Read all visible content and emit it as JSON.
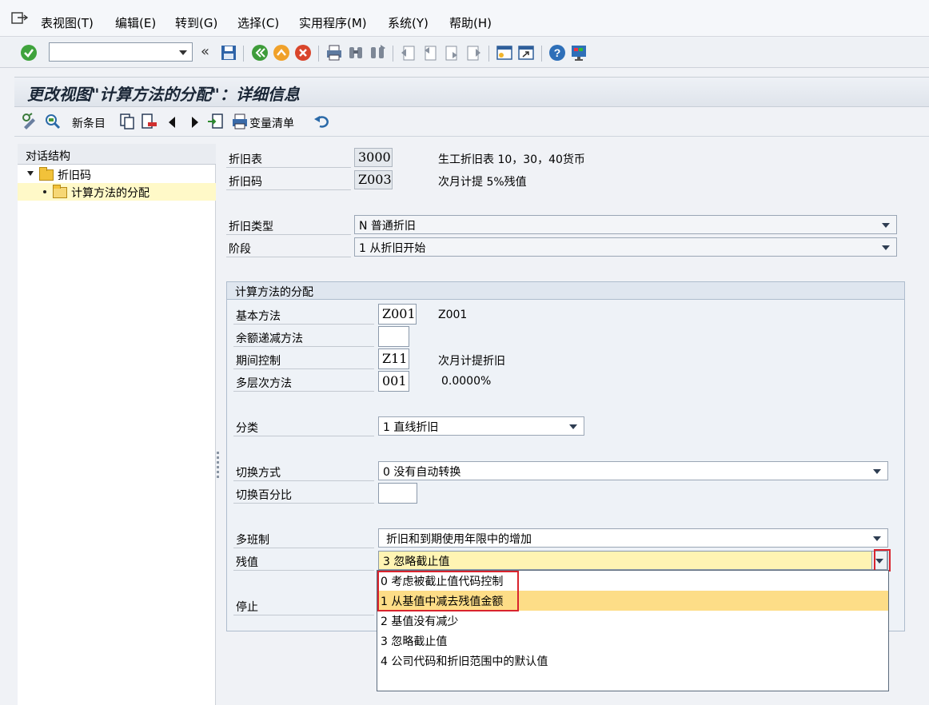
{
  "menu": {
    "items": [
      "表视图(T)",
      "编辑(E)",
      "转到(G)",
      "选择(C)",
      "实用程序(M)",
      "系统(Y)",
      "帮助(H)"
    ]
  },
  "toolbar": {
    "command_value": "",
    "icons": [
      "enter-icon",
      "save-icon",
      "back-icon",
      "exit-icon",
      "cancel-icon",
      "print-icon",
      "find-icon",
      "find-next-icon",
      "first-page-icon",
      "previous-page-icon",
      "next-page-icon",
      "last-page-icon",
      "create-session-icon",
      "shortcut-icon",
      "help-icon",
      "customize-layout-icon"
    ]
  },
  "title": "更改视图\"计算方法的分配\"：详细信息",
  "app_toolbar": {
    "new_entries": "新条目",
    "variable_list": "变量清单"
  },
  "nav": {
    "header": "对话结构",
    "items": [
      {
        "label": "折旧码"
      },
      {
        "label": "计算方法的分配"
      }
    ]
  },
  "form": {
    "dep_key_table": {
      "label": "折旧表",
      "value": "3000",
      "text": "生工折旧表 10，30，40货币"
    },
    "dep_key": {
      "label": "折旧码",
      "value": "Z003",
      "text": "次月计提 5%残值"
    },
    "dep_type": {
      "label": "折旧类型",
      "value": "N 普通折旧"
    },
    "phase": {
      "label": "阶段",
      "value": "1 从折旧开始"
    },
    "group": {
      "title": "计算方法的分配",
      "base_method": {
        "label": "基本方法",
        "value": "Z001",
        "text": "Z001"
      },
      "declining_method": {
        "label": "余额递减方法",
        "value": ""
      },
      "period_control": {
        "label": "期间控制",
        "value": "Z11",
        "text": "次月计提折旧"
      },
      "multilevel": {
        "label": "多层次方法",
        "value": "001",
        "text": "0.0000%"
      },
      "class": {
        "label": "分类",
        "value": "1 直线折旧"
      },
      "changeover_method": {
        "label": "切换方式",
        "value": "0 没有自动转换"
      },
      "changeover_pct": {
        "label": "切换百分比",
        "value": ""
      },
      "multishift": {
        "label": "多班制",
        "value": "折旧和到期使用年限中的增加"
      },
      "residual": {
        "label": "残值",
        "value": "3 忽略截止值"
      },
      "stop": {
        "label": "停止"
      }
    }
  },
  "dropdown": {
    "options": [
      "0 考虑被截止值代码控制",
      "1 从基值中减去残值金额",
      "2 基值没有减少",
      "3 忽略截止值",
      "4 公司代码和折旧范围中的默认值"
    ],
    "highlighted_index": 1
  },
  "colors": {
    "highlight": "#fddd87",
    "focus_field": "#fff4b3",
    "annotation_red": "#d9232d"
  }
}
